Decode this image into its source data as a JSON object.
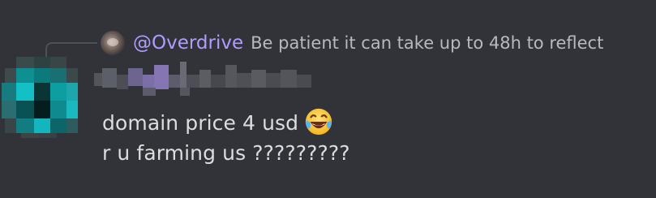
{
  "reply": {
    "username": "@Overdrive",
    "content": "Be patient it can take up to 48h to reflect"
  },
  "author": {
    "name_obscured": true,
    "avatar_colors": [
      "#11c3c8",
      "#0b6e70",
      "#063b3c"
    ]
  },
  "message": {
    "lines": [
      "domain price 4 usd",
      "r u farming us ?????????"
    ],
    "emoji": "face-with-tears-of-joy-icon"
  },
  "colors": {
    "background": "#313338",
    "text": "#dbdee1",
    "muted_text": "#b5bac1",
    "mention": "#b09cff"
  }
}
